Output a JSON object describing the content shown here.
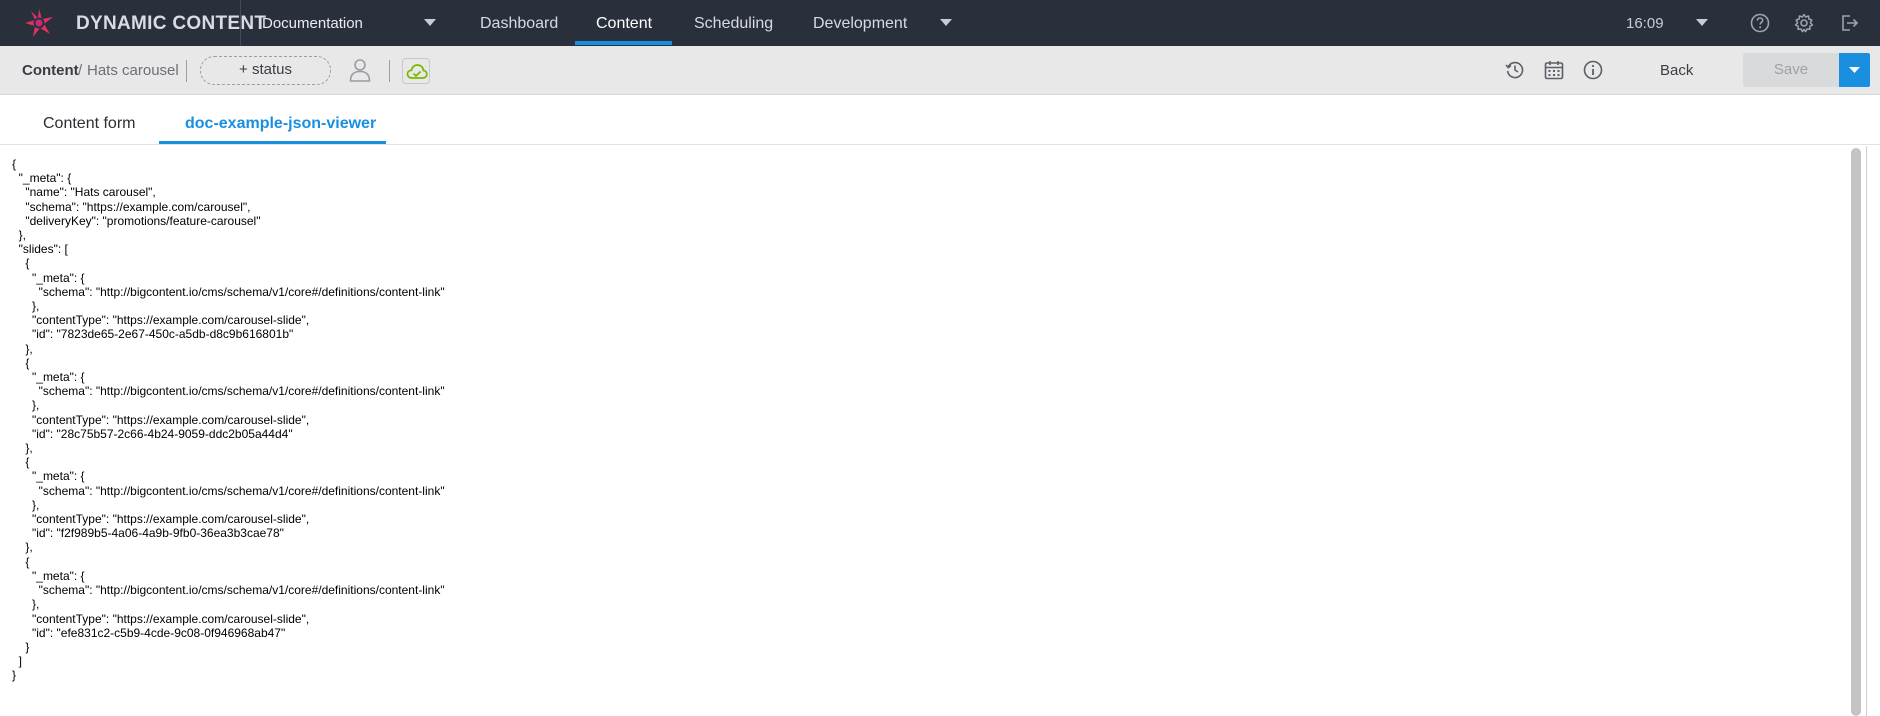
{
  "header": {
    "brand": "DYNAMIC CONTENT",
    "hub": "Documentation",
    "nav": [
      {
        "label": "Dashboard"
      },
      {
        "label": "Content"
      },
      {
        "label": "Scheduling"
      },
      {
        "label": "Development"
      }
    ],
    "active_nav": "Content",
    "time": "16:09"
  },
  "toolbar": {
    "breadcrumb_root": "Content",
    "breadcrumb_sep": "/",
    "breadcrumb_leaf": "Hats carousel",
    "status_label": "+ status",
    "back_label": "Back",
    "save_label": "Save"
  },
  "tabs": [
    {
      "label": "Content form"
    },
    {
      "label": "doc-example-json-viewer"
    }
  ],
  "active_tab": "doc-example-json-viewer",
  "json_text": "{\n  \"_meta\": {\n    \"name\": \"Hats carousel\",\n    \"schema\": \"https://example.com/carousel\",\n    \"deliveryKey\": \"promotions/feature-carousel\"\n  },\n  \"slides\": [\n    {\n      \"_meta\": {\n        \"schema\": \"http://bigcontent.io/cms/schema/v1/core#/definitions/content-link\"\n      },\n      \"contentType\": \"https://example.com/carousel-slide\",\n      \"id\": \"7823de65-2e67-450c-a5db-d8c9b616801b\"\n    },\n    {\n      \"_meta\": {\n        \"schema\": \"http://bigcontent.io/cms/schema/v1/core#/definitions/content-link\"\n      },\n      \"contentType\": \"https://example.com/carousel-slide\",\n      \"id\": \"28c75b57-2c66-4b24-9059-ddc2b05a44d4\"\n    },\n    {\n      \"_meta\": {\n        \"schema\": \"http://bigcontent.io/cms/schema/v1/core#/definitions/content-link\"\n      },\n      \"contentType\": \"https://example.com/carousel-slide\",\n      \"id\": \"f2f989b5-4a06-4a9b-9fb0-36ea3b3cae78\"\n    },\n    {\n      \"_meta\": {\n        \"schema\": \"http://bigcontent.io/cms/schema/v1/core#/definitions/content-link\"\n      },\n      \"contentType\": \"https://example.com/carousel-slide\",\n      \"id\": \"efe831c2-c5b9-4cde-9c08-0f946968ab47\"\n    }\n  ]\n}",
  "icons": {
    "logo": "dynamic-content-logo-icon",
    "hub_dropdown": "caret-down-icon",
    "help": "help-icon",
    "settings": "gear-icon",
    "logout": "logout-icon",
    "user": "user-icon",
    "cloud": "cloud-sync-icon",
    "history": "history-icon",
    "calendar": "calendar-icon",
    "info": "info-icon"
  },
  "colors": {
    "nav_bg": "#2a2f3c",
    "accent": "#1a8fe0",
    "toolbar_bg": "#e8e8e8",
    "cloud_ok": "#7ab800"
  }
}
